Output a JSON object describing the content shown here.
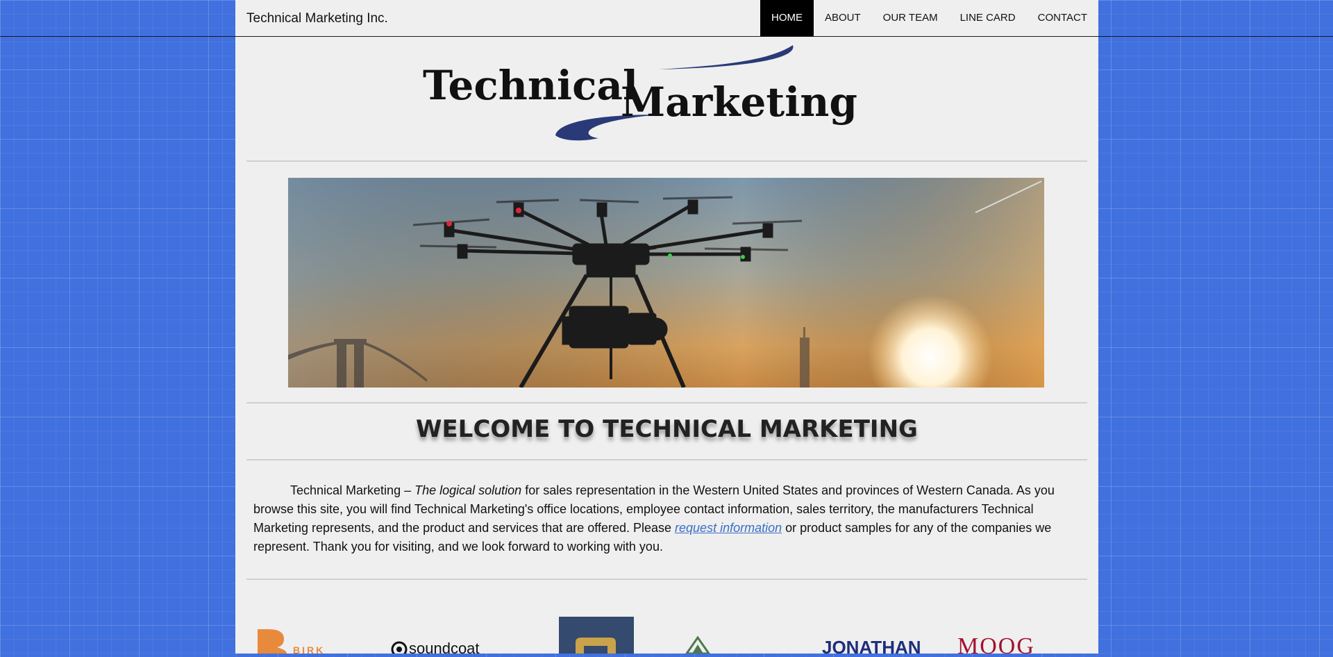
{
  "header": {
    "site_title": "Technical Marketing Inc.",
    "nav": [
      {
        "label": "HOME",
        "active": true
      },
      {
        "label": "ABOUT",
        "active": false
      },
      {
        "label": "OUR TEAM",
        "active": false
      },
      {
        "label": "LINE CARD",
        "active": false
      },
      {
        "label": "CONTACT",
        "active": false
      }
    ]
  },
  "logo": {
    "word1": "Technical",
    "word2": "Marketing",
    "swoosh_color": "#2a3a78"
  },
  "welcome": {
    "heading": "WELCOME TO TECHNICAL MARKETING"
  },
  "intro": {
    "company": "Technical Marketing – ",
    "tagline": "The logical solution",
    "text_a": " for sales representation in the Western United States and provinces of Western Canada. As you browse this site, you will find Technical Marketing's office locations, employee contact information, sales territory, the manufacturers Technical Marketing represents, and the product and services that are offered. Please ",
    "link": "request information",
    "text_b": " or product samples for any of the companies we represent. Thank you for visiting, and we look forward to working with you."
  },
  "partner_logos": {
    "birk": "BIRK",
    "soundcoat": "soundcoat",
    "jonathan": "JONATHAN",
    "moog": "MOOG"
  },
  "colors": {
    "background": "#4170df",
    "page": "#efefef",
    "link": "#3a6fc4",
    "nav_active_bg": "#000000"
  }
}
